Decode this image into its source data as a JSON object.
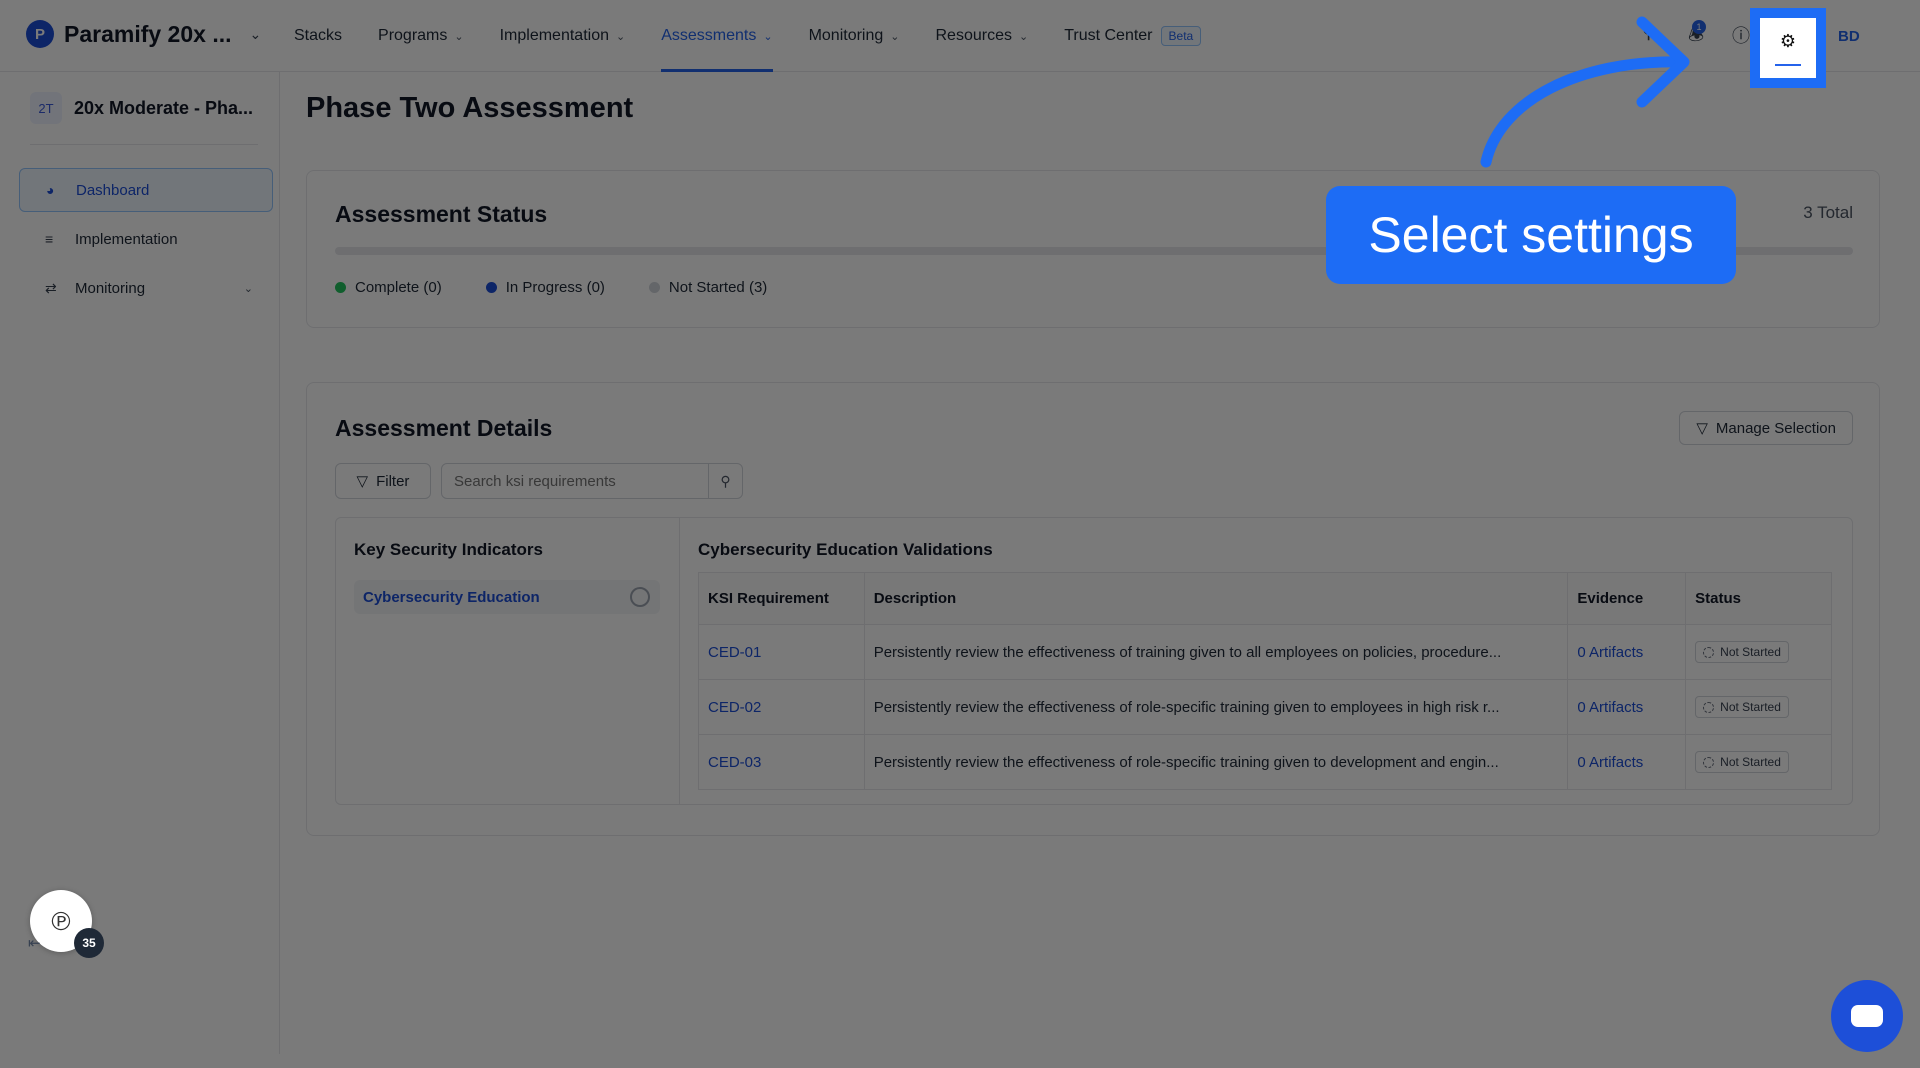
{
  "topbar": {
    "brand_name": "Paramify 20x ...",
    "nav": [
      {
        "label": "Stacks"
      },
      {
        "label": "Programs"
      },
      {
        "label": "Implementation"
      },
      {
        "label": "Assessments"
      },
      {
        "label": "Monitoring"
      },
      {
        "label": "Resources"
      },
      {
        "label": "Trust Center"
      }
    ],
    "beta_label": "Beta",
    "notification_count": "1",
    "user_initials": "BD"
  },
  "sidebar": {
    "project_badge": "2T",
    "project_name": "20x Moderate - Pha...",
    "items": [
      {
        "label": "Dashboard"
      },
      {
        "label": "Implementation"
      },
      {
        "label": "Monitoring"
      }
    ],
    "help_count": "35"
  },
  "main": {
    "page_title": "Phase Two Assessment",
    "status": {
      "title": "Assessment Status",
      "total_label": "3 Total",
      "progress_complete_fraction": 0,
      "legend": [
        {
          "label": "Complete (0)",
          "color": "#22c55e"
        },
        {
          "label": "In Progress (0)",
          "color": "#1d4ed8"
        },
        {
          "label": "Not Started (3)",
          "color": "#d1d5db"
        }
      ]
    },
    "details": {
      "title": "Assessment Details",
      "manage_label": "Manage Selection",
      "filter_label": "Filter",
      "search_placeholder": "Search ksi requirements",
      "ksi_title": "Key Security Indicators",
      "ksi_item": "Cybersecurity Education",
      "validations_title": "Cybersecurity Education Validations",
      "columns": [
        "KSI Requirement",
        "Description",
        "Evidence",
        "Status"
      ],
      "rows": [
        {
          "req": "CED-01",
          "desc": "Persistently review the effectiveness of training given to all employees on policies, procedure...",
          "evidence": "0 Artifacts",
          "status": "Not Started"
        },
        {
          "req": "CED-02",
          "desc": "Persistently review the effectiveness of role-specific training given to employees in high risk r...",
          "evidence": "0 Artifacts",
          "status": "Not Started"
        },
        {
          "req": "CED-03",
          "desc": "Persistently review the effectiveness of role-specific training given to development and engin...",
          "evidence": "0 Artifacts",
          "status": "Not Started"
        }
      ]
    }
  },
  "annotation": {
    "callout_text": "Select settings"
  },
  "colors": {
    "accent": "#2563eb",
    "annotation_blue": "#1d6cf5"
  }
}
